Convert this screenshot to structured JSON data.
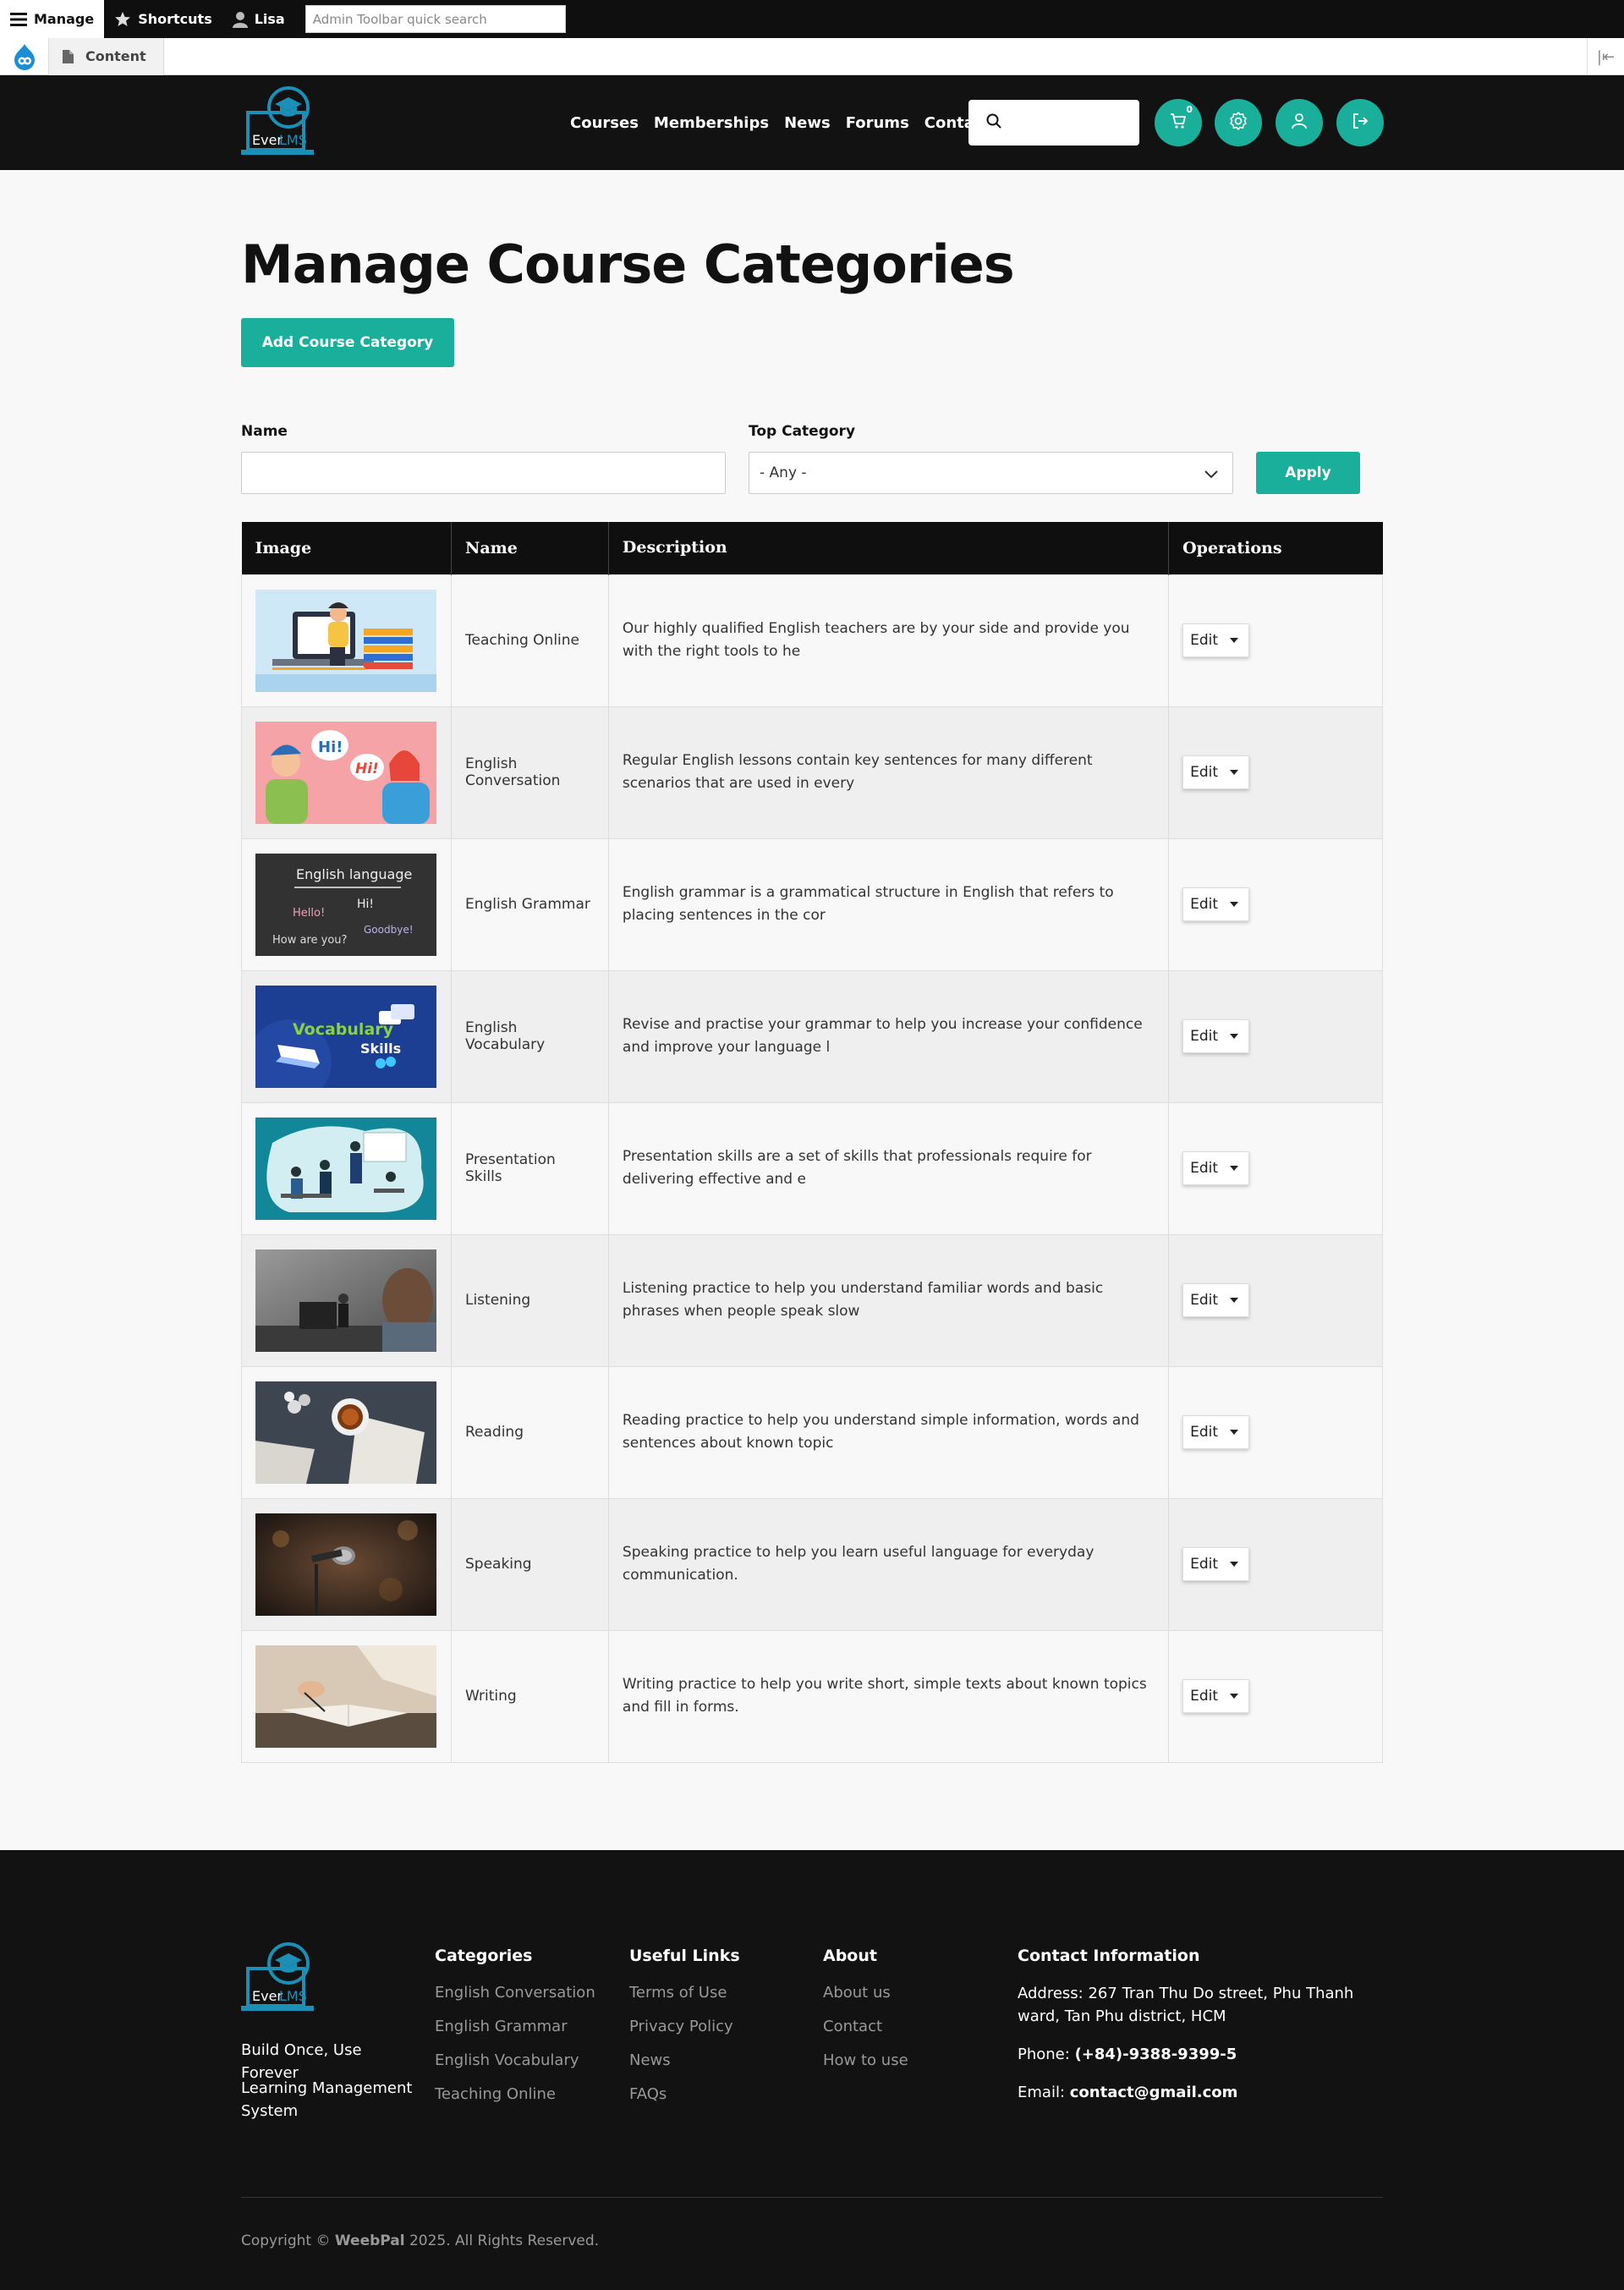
{
  "admin_toolbar": {
    "manage": "Manage",
    "shortcuts": "Shortcuts",
    "user": "Lisa",
    "search_placeholder": "Admin Toolbar quick search"
  },
  "tray": {
    "content": "Content"
  },
  "header": {
    "logo_text_1": "Ever",
    "logo_text_2": "LMS",
    "nav": [
      "Courses",
      "Memberships",
      "News",
      "Forums",
      "Contact Us"
    ],
    "cart_count": "0",
    "search_placeholder": ""
  },
  "main": {
    "title": "Manage Course Categories",
    "add_button": "Add Course Category",
    "filters": {
      "name_label": "Name",
      "name_value": "",
      "top_category_label": "Top Category",
      "top_category_value": "- Any -",
      "apply": "Apply"
    },
    "table": {
      "headers": [
        "Image",
        "Name",
        "Description",
        "Operations"
      ],
      "edit_label": "Edit",
      "rows": [
        {
          "name": "Teaching Online",
          "description": "Our highly qualified English teachers are by your side and provide you with the right tools to he"
        },
        {
          "name": "English Conversation",
          "description": "Regular English lessons contain key sentences for many different scenarios that are used in every"
        },
        {
          "name": "English Grammar",
          "description": "English grammar is a grammatical structure in English that refers to placing sentences in the cor"
        },
        {
          "name": "English Vocabulary",
          "description": "Revise and practise your grammar to help you increase your confidence and improve your language l"
        },
        {
          "name": "Presentation Skills",
          "description": "Presentation skills are a set of skills that professionals require for delivering effective and e"
        },
        {
          "name": "Listening",
          "description": "Listening practice to help you understand familiar words and basic phrases when people speak slow"
        },
        {
          "name": "Reading",
          "description": "Reading practice to help you understand simple information, words and sentences about known topic"
        },
        {
          "name": "Speaking",
          "description": "Speaking practice to help you learn useful language for everyday communication."
        },
        {
          "name": "Writing",
          "description": "Writing practice to help you write short, simple texts about known topics and fill in forms."
        }
      ]
    },
    "thumbnail_text": {
      "conversation_hi_1": "Hi!",
      "conversation_hi_2": "Hi!",
      "grammar_title": "English language",
      "grammar_hello": "Hello!",
      "grammar_hi": "Hi!",
      "grammar_how": "How are you?",
      "grammar_goodbye": "Goodbye!",
      "vocab_1": "Vocabulary",
      "vocab_2": "Skills"
    }
  },
  "footer": {
    "tagline_1": "Build Once, Use Forever",
    "tagline_2": "Learning Management System",
    "categories": {
      "title": "Categories",
      "links": [
        "English Conversation",
        "English Grammar",
        "English Vocabulary",
        "Teaching Online"
      ]
    },
    "useful_links": {
      "title": "Useful Links",
      "links": [
        "Terms of Use",
        "Privacy Policy",
        "News",
        "FAQs"
      ]
    },
    "about": {
      "title": "About",
      "links": [
        "About us",
        "Contact",
        "How to use"
      ]
    },
    "contact": {
      "title": "Contact Information",
      "address_label": "Address:",
      "address": "267 Tran Thu Do street, Phu Thanh ward, Tan Phu district, HCM",
      "phone_label": "Phone:",
      "phone": "(+84)-9388-9399-5",
      "email_label": "Email:",
      "email": "contact@gmail.com"
    },
    "copyright_prefix": "Copyright ©",
    "copyright_brand": "WeebPal",
    "copyright_suffix": " 2025. All Rights Reserved."
  },
  "colors": {
    "accent": "#1aaf9a",
    "dark": "#121212",
    "logo_blue": "#1b8fb5"
  }
}
